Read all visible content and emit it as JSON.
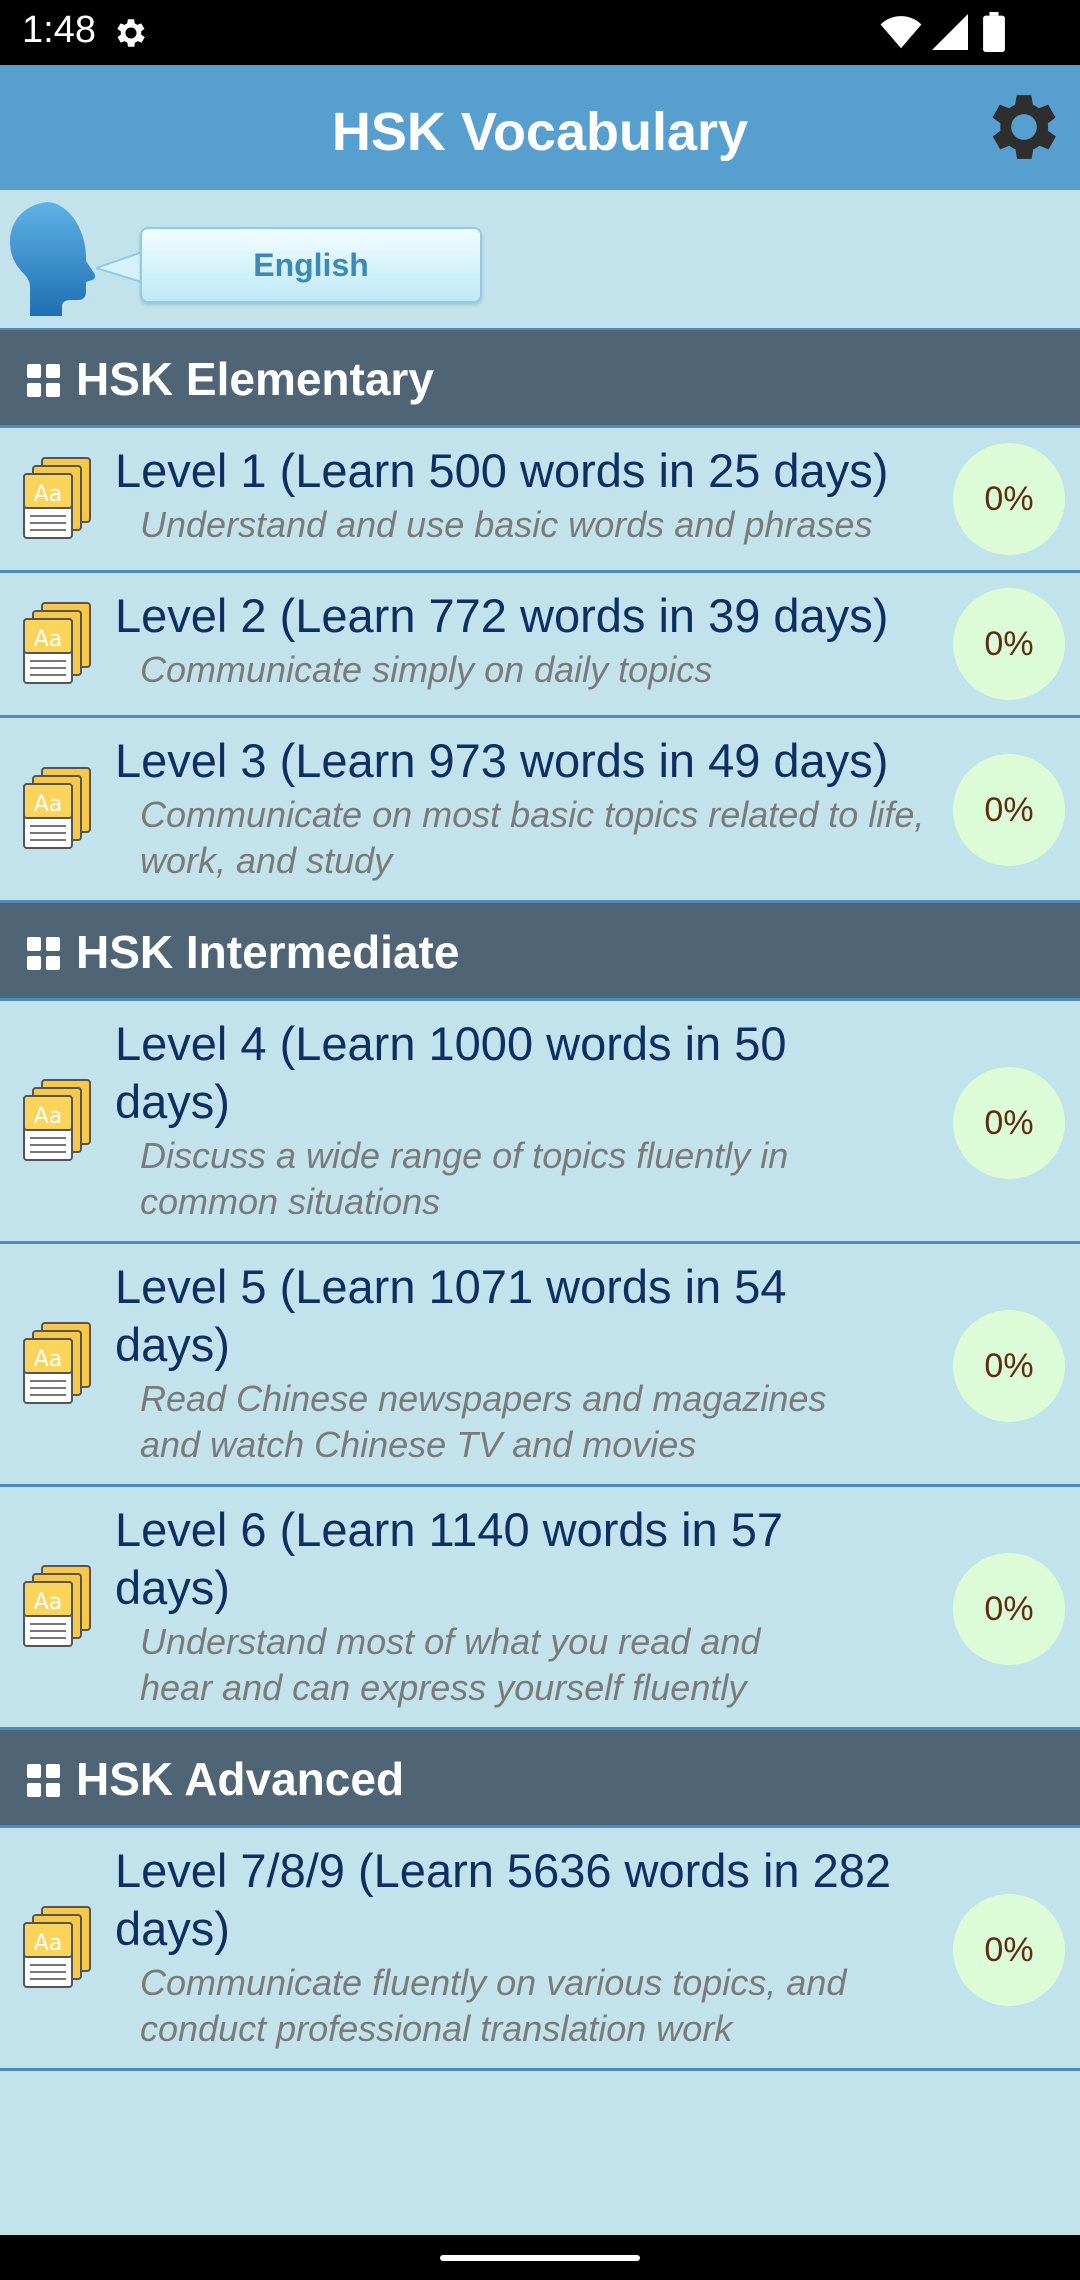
{
  "status_bar": {
    "time": "1:48"
  },
  "app_bar": {
    "title": "HSK Vocabulary"
  },
  "language": {
    "label": "English"
  },
  "sections": [
    {
      "title": "HSK Elementary"
    },
    {
      "title": "HSK Intermediate"
    },
    {
      "title": "HSK Advanced"
    }
  ],
  "levels": [
    {
      "title": "Level 1 (Learn 500 words in 25 days)",
      "desc": "Understand and use basic words and phrases",
      "progress": "0%"
    },
    {
      "title": "Level 2 (Learn 772 words in 39 days)",
      "desc": "Communicate simply on daily topics",
      "progress": "0%"
    },
    {
      "title": "Level 3 (Learn 973 words in 49 days)",
      "desc": "Communicate on most basic topics related to life, work, and study",
      "progress": "0%"
    },
    {
      "title": "Level 4 (Learn 1000 words in 50 days)",
      "desc": "Discuss a wide range of topics fluently in common situations",
      "progress": "0%"
    },
    {
      "title": "Level 5 (Learn 1071 words in 54 days)",
      "desc": "Read Chinese newspapers and magazines and watch Chinese TV and movies",
      "progress": "0%"
    },
    {
      "title": "Level 6 (Learn 1140 words in 57 days)",
      "desc": "Understand most of what you read and hear and can express yourself fluently",
      "progress": "0%"
    },
    {
      "title": "Level 7/8/9 (Learn 5636 words in 282 days)",
      "desc": "Communicate fluently on various topics, and conduct professional translation work",
      "progress": "0%"
    }
  ],
  "colors": {
    "app_bar": "#569fcf",
    "background": "#c2e3ec",
    "section_header": "#4f6576",
    "progress_circle": "#dcfcd8"
  },
  "icons": {
    "settings": "gear-icon",
    "status_gear": "gear-icon",
    "wifi": "wifi-icon",
    "signal": "signal-icon",
    "battery": "battery-icon",
    "speaker": "speaking-head-icon",
    "section": "grid-icon",
    "level": "flashcards-icon"
  }
}
